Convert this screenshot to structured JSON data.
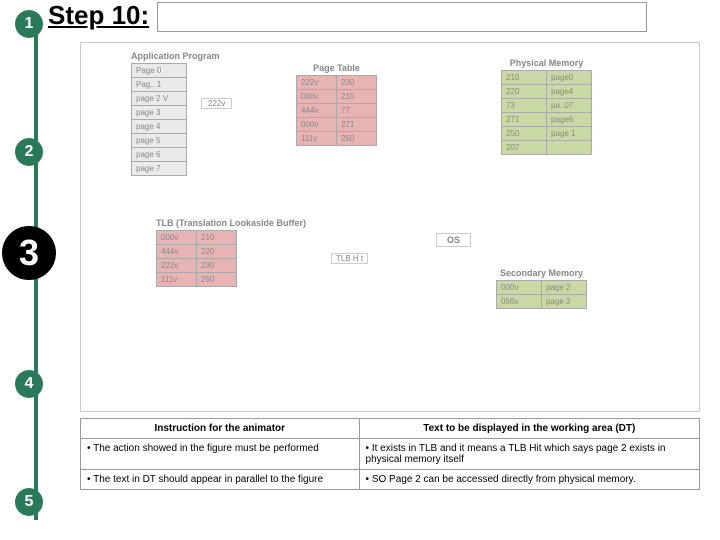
{
  "header": {
    "step_label": "Step 10:"
  },
  "timeline": {
    "n1": "1",
    "n2": "2",
    "n3": "3",
    "n4": "4",
    "n5": "5"
  },
  "app_program": {
    "title": "Application Program",
    "rows": [
      "Page 0",
      "Pag.. 1",
      "page 2 V",
      "page 3",
      "page 4",
      "page 5",
      "page 6",
      "page 7"
    ]
  },
  "label_222v": "222v",
  "page_table": {
    "title": "Page Table",
    "rows": [
      [
        "222v",
        "230"
      ],
      [
        "000v",
        "210"
      ],
      [
        "444v",
        "77"
      ],
      [
        "000v",
        "271"
      ],
      [
        "111v",
        "250"
      ]
    ]
  },
  "phys_mem": {
    "title": "Physical Memory",
    "rows": [
      [
        "210",
        "page0"
      ],
      [
        "220",
        "page4"
      ],
      [
        "73",
        "pa..07"
      ],
      [
        "271",
        "page6"
      ],
      [
        "250",
        "page 1"
      ],
      [
        "207",
        ""
      ]
    ]
  },
  "tlb": {
    "title": "TLB (Translation Lookaside Buffer)",
    "rows": [
      [
        "000v",
        "210"
      ],
      [
        "444v",
        "220"
      ],
      [
        "222v",
        "230"
      ],
      [
        "111v",
        "250"
      ]
    ]
  },
  "tlb_hit": "TLB H t",
  "os_label": "OS",
  "sec_mem": {
    "title": "Secondary Memory",
    "rows": [
      [
        "000v",
        "page 2"
      ],
      [
        "056v",
        "page 3"
      ]
    ]
  },
  "instr": {
    "h1": "Instruction for the animator",
    "h2": "Text to be displayed in the working area (DT)",
    "r1c1": "• The action showed in the figure must be performed",
    "r1c2": "• It exists in TLB and it means a TLB Hit which says page 2 exists in physical memory itself",
    "r2c1": "• The text in DT should appear  in parallel to the figure",
    "r2c2": "• SO Page 2 can be accessed directly from physical memory."
  }
}
